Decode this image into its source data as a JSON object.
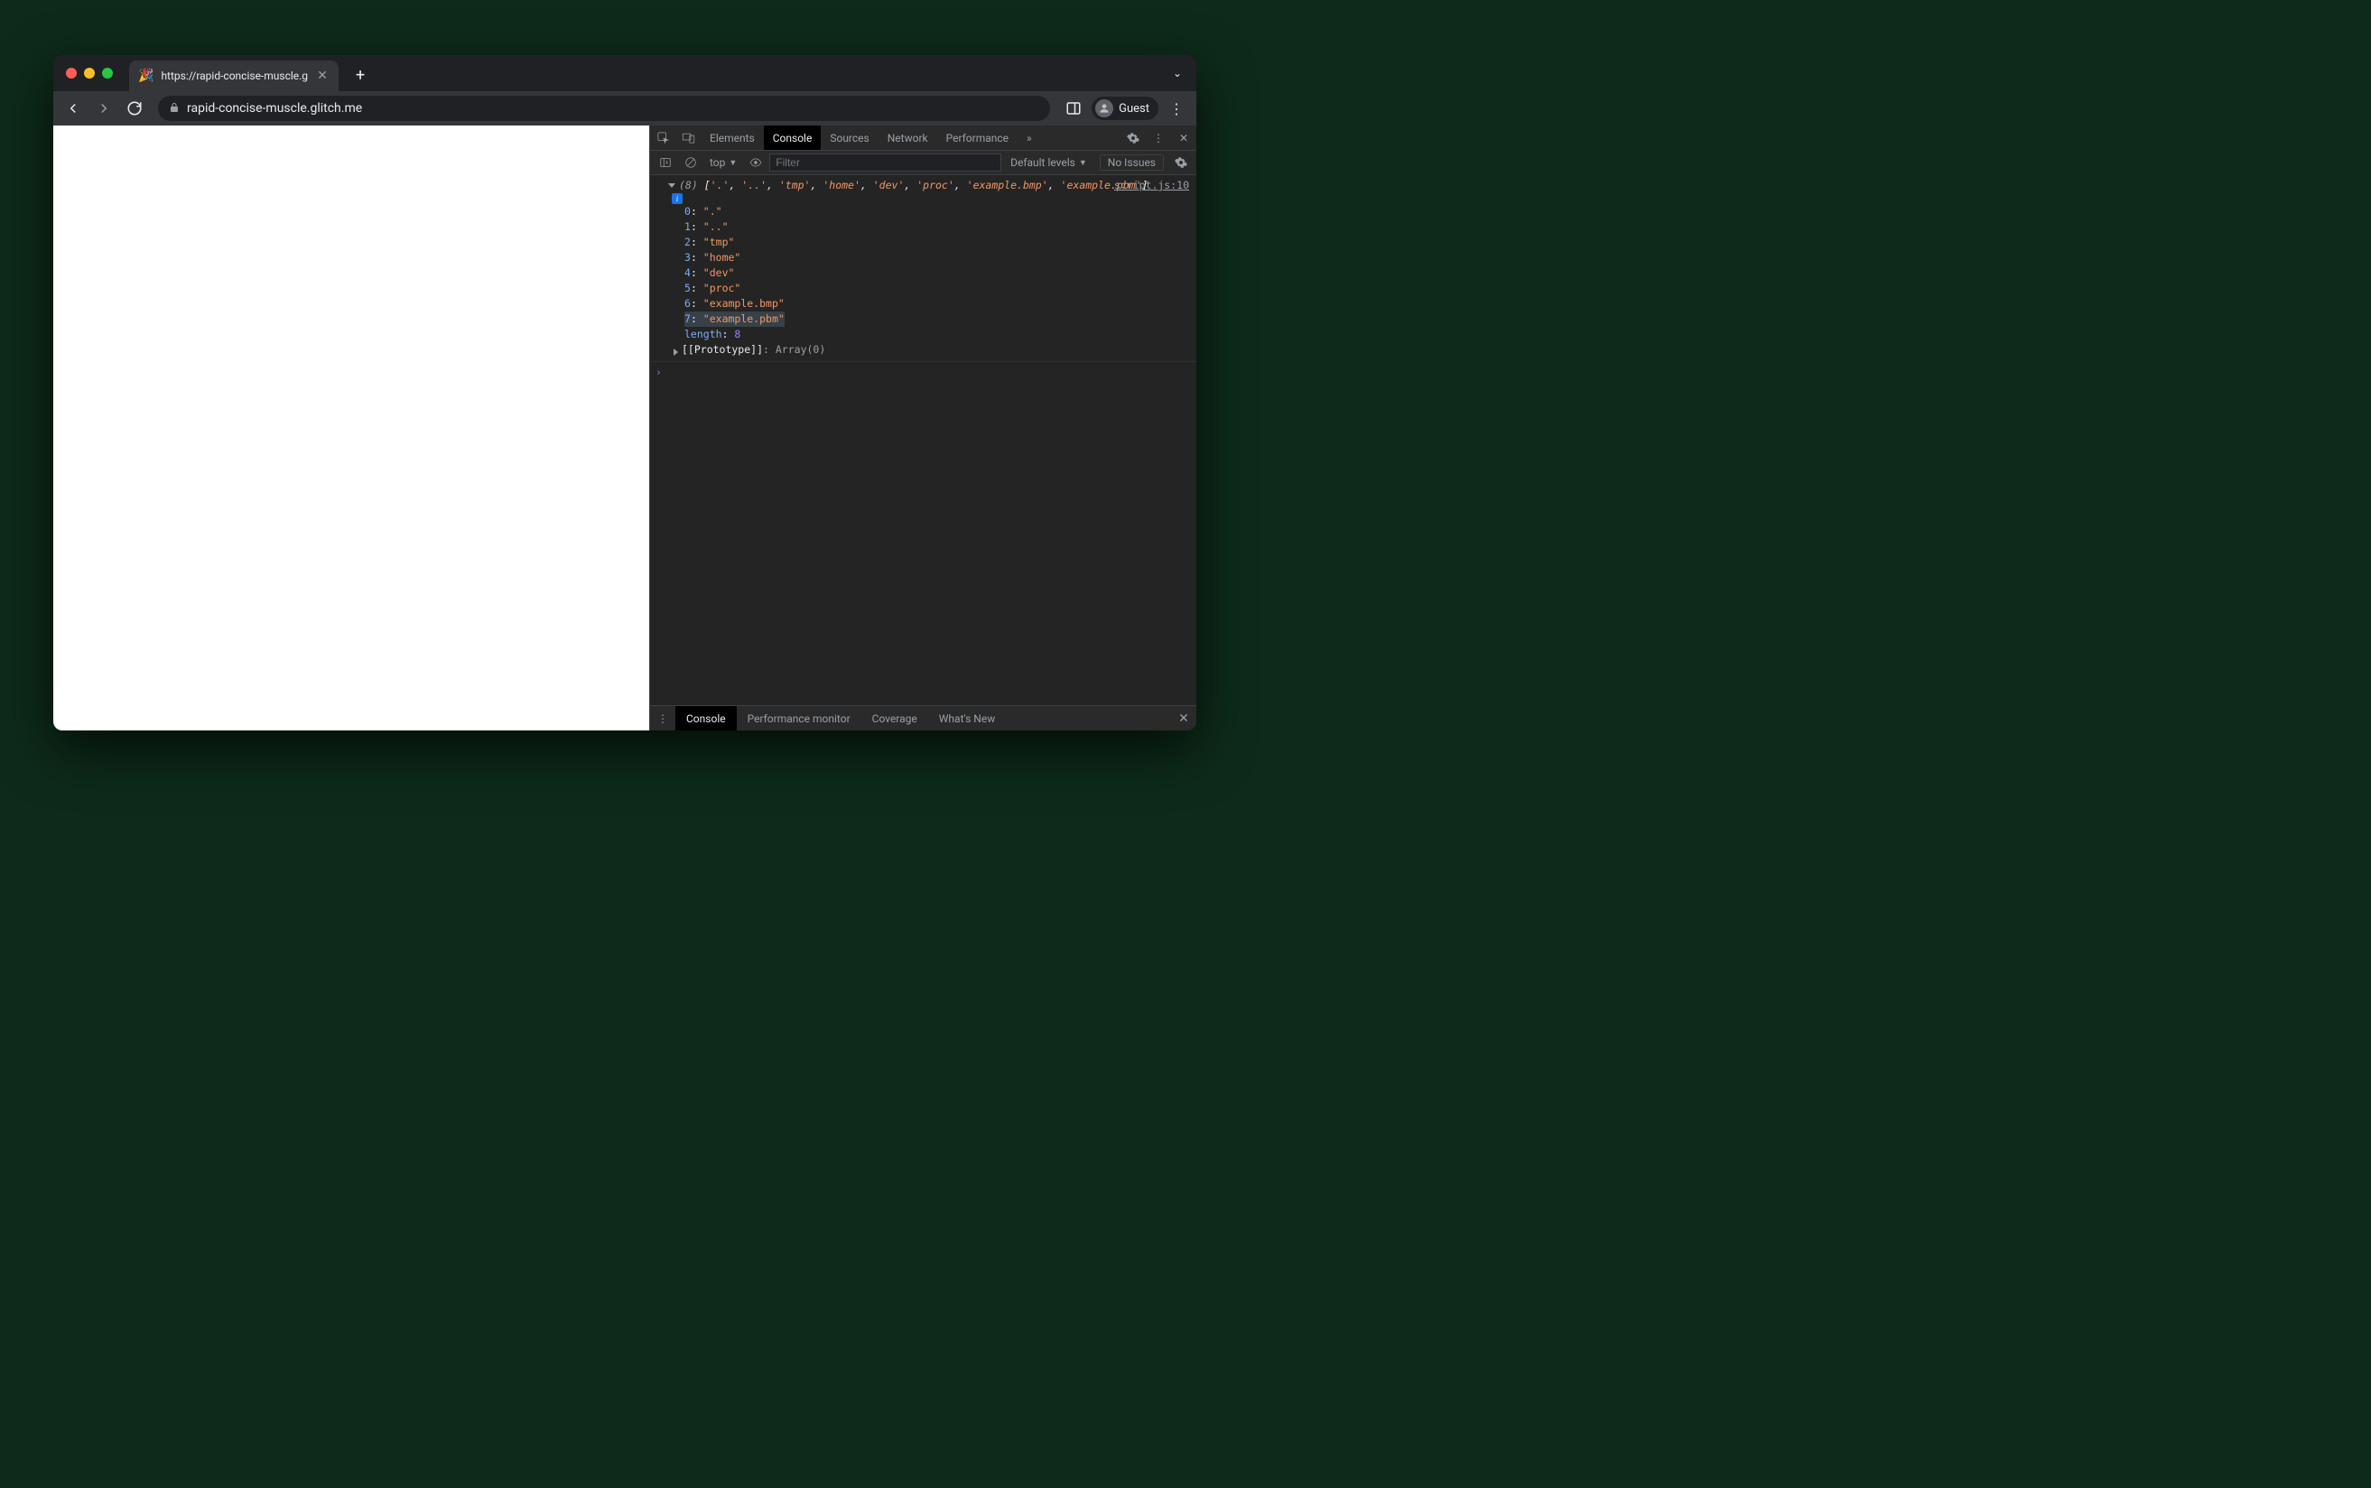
{
  "browser": {
    "tab": {
      "favicon": "🎉",
      "title": "https://rapid-concise-muscle.g"
    },
    "url": "rapid-concise-muscle.glitch.me",
    "guest_label": "Guest"
  },
  "devtools": {
    "tabs": [
      "Elements",
      "Console",
      "Sources",
      "Network",
      "Performance"
    ],
    "active_tab": "Console",
    "more_tabs_glyph": "»",
    "toolbar": {
      "context": "top",
      "filter_placeholder": "Filter",
      "levels": "Default levels",
      "issues": "No Issues"
    },
    "log": {
      "source": "script.js:10",
      "length": 8,
      "items": [
        ".",
        "..",
        "tmp",
        "home",
        "dev",
        "proc",
        "example.bmp",
        "example.pbm"
      ],
      "length_key": "length",
      "length_value": "8",
      "highlighted_index": 7,
      "proto_label": "[[Prototype]]",
      "proto_value": "Array(0)"
    },
    "drawer": {
      "tabs": [
        "Console",
        "Performance monitor",
        "Coverage",
        "What's New"
      ],
      "active": "Console"
    }
  }
}
